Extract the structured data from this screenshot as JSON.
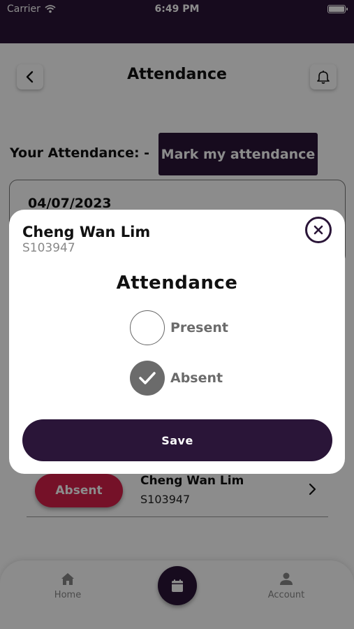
{
  "status_bar": {
    "carrier": "Carrier",
    "time": "6:49 PM"
  },
  "header": {
    "title": "Attendance"
  },
  "attendance_row": {
    "label": "Your Attendance: -",
    "mark_button": "Mark my attendance"
  },
  "date_card": {
    "date": "04/07/2023"
  },
  "student_row": {
    "status": "Absent",
    "name": "Cheng Wan Lim",
    "id": "S103947"
  },
  "bottom_nav": {
    "home_label": "Home",
    "account_label": "Account"
  },
  "modal": {
    "name": "Cheng Wan Lim",
    "id": "S103947",
    "title": "Attendance",
    "options": [
      {
        "label": "Present",
        "selected": false
      },
      {
        "label": "Absent",
        "selected": true
      }
    ],
    "save_label": "Save"
  },
  "colors": {
    "primary": "#2a1538",
    "absent": "#d61f4a",
    "muted": "#6b6b6b"
  },
  "icons": [
    "back-chevron-icon",
    "bell-icon",
    "wifi-icon",
    "battery-icon",
    "chevron-right-icon",
    "home-icon",
    "calendar-icon",
    "account-icon",
    "close-icon",
    "check-icon"
  ]
}
